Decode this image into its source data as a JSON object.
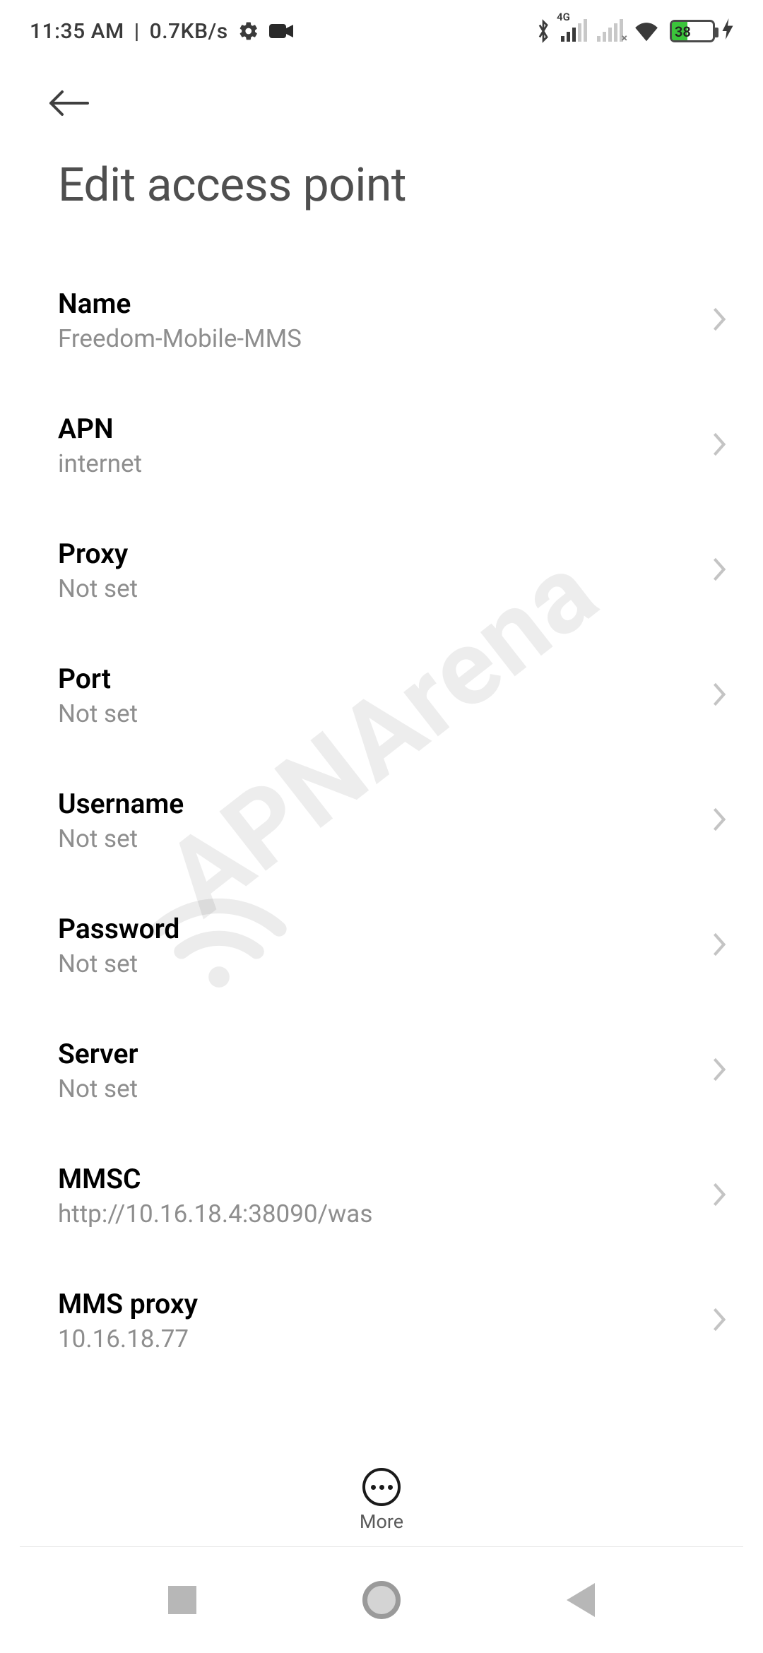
{
  "status": {
    "time": "11:35 AM",
    "sep": "|",
    "speed": "0.7KB/s",
    "battery_pct": "38",
    "sig1_label": "4G"
  },
  "page": {
    "title": "Edit access point"
  },
  "rows": [
    {
      "label": "Name",
      "value": "Freedom-Mobile-MMS"
    },
    {
      "label": "APN",
      "value": "internet"
    },
    {
      "label": "Proxy",
      "value": "Not set"
    },
    {
      "label": "Port",
      "value": "Not set"
    },
    {
      "label": "Username",
      "value": "Not set"
    },
    {
      "label": "Password",
      "value": "Not set"
    },
    {
      "label": "Server",
      "value": "Not set"
    },
    {
      "label": "MMSC",
      "value": "http://10.16.18.4:38090/was"
    },
    {
      "label": "MMS proxy",
      "value": "10.16.18.77"
    }
  ],
  "more_label": "More",
  "watermark": "APNArena"
}
